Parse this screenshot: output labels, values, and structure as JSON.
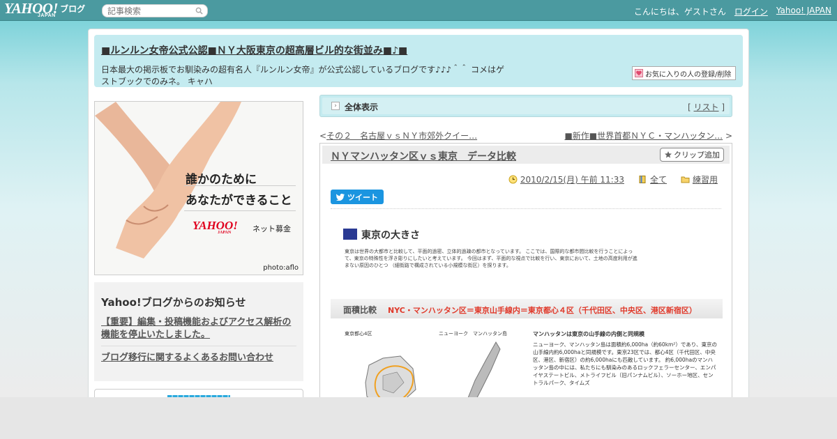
{
  "topbar": {
    "logo_text": "YAHOO!",
    "logo_japan": "JAPAN",
    "logo_blog": "ブログ",
    "search_placeholder": "記事検索",
    "greeting": "こんにちは、ゲストさん",
    "login": "ログイン",
    "yahoo_japan_link": "Yahoo! JAPAN"
  },
  "header": {
    "title": "■ルンルン女帝公式公認■ＮＹ大阪東京の超高層ビル的な街並み■♪■",
    "description": "日本最大の掲示板でお馴染みの超有名人『ルンルン女帝』が公式公認しているブログです♪♪♪＾＾ コメはゲストブックでのみネ。 キャハ",
    "fav_button": "お気に入りの人の登録/削除"
  },
  "ad": {
    "line1": "誰かのために",
    "line2": "あなたができること",
    "logo": "YAHOO!",
    "logo_sub": "JAPAN",
    "service": "ネット募金",
    "credit": "photo:aflo"
  },
  "notice": {
    "title": "Yahoo!ブログからのお知らせ",
    "items": [
      "【重要】編集・投稿機能およびアクセス解析の機能を停止いたしました。",
      "ブログ移行に関するよくあるお問い合わせ"
    ]
  },
  "listbar": {
    "label": "全体表示",
    "link": "リスト"
  },
  "nav": {
    "prev": "その２　名古屋ｖｓＮＹ市郊外クイー…",
    "next": "■新作■世界首都ＮＹＣ・マンハッタン…"
  },
  "article": {
    "title": "ＮＹマンハッタン区ｖｓ東京　データ比較",
    "clip_button": "クリップ追加",
    "date": "2010/2/15(月) 午前 11:33",
    "category_all": "全て",
    "category": "練習用",
    "tweet": "ツイート"
  },
  "embed": {
    "title": "東京の大きさ",
    "para": "東京は世界の大都市と比較して、平面的過密、立体的過疎の都市となっています。 ここでは、国際的な都市間比較を行うことによって、東京の特殊性を浮き彫りにしたいと考えています。 今回はまず、平面的な視点で比較を行い、東京において、土地の高度利用が進まない原因のひとつ （細街路で構成されている小規模な街区）を探ります。",
    "band_title": "面積比較",
    "band_red": "NYC・マンハッタン区＝東京山手線内＝東京都心４区（千代田区、中央区、港区新宿区）",
    "map_left": "東京都心4区",
    "map_mid": "ニューヨーク　マンハッタン島",
    "para2_title": "マンハッタンは東京の山手線の内側と同規模",
    "para2": "ニューヨーク、マンハッタン島は面積約6,000ha（約60km²）であり、東京の山手線内約6,000haと同規模です。東京23区では、都心4区（千代田区、中央区、港区、新宿区）の約6,000haにも匹敵しています。 約6,000haのマンハッタン島の中には、私たちにも馴染みのあるロックフェラーセンター、エンパイヤステートビル、メトライフビル（旧パンナムビル）、ソーホー地区、セントラルパーク、タイムズ"
  },
  "colors": {
    "topbar": "#4b9aa0",
    "header_bg": "#c4ebf0",
    "tweet": "#1b95e0",
    "accent_red": "#e0392a",
    "embed_square": "#2a3a93"
  }
}
